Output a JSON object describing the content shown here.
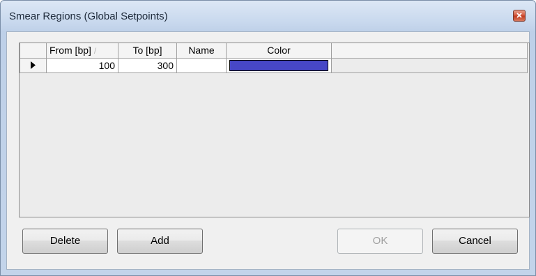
{
  "window": {
    "title": "Smear Regions (Global Setpoints)"
  },
  "grid": {
    "columns": [
      {
        "label": "From [bp]",
        "sort_indicator": "/"
      },
      {
        "label": "To [bp]"
      },
      {
        "label": "Name"
      },
      {
        "label": "Color"
      }
    ],
    "rows": [
      {
        "from": "100",
        "to": "300",
        "name": "",
        "color": "#4747c7"
      }
    ]
  },
  "buttons": {
    "delete": "Delete",
    "add": "Add",
    "ok": "OK",
    "cancel": "Cancel"
  },
  "icons": {
    "close": "close-icon",
    "current_row": "row-pointer-icon"
  }
}
